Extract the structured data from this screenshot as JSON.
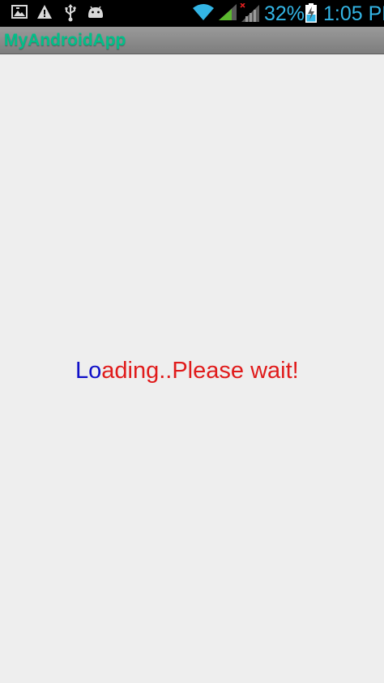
{
  "status_bar": {
    "icons_left": [
      "gallery-notification-icon",
      "warning-icon",
      "usb-icon",
      "android-debug-icon"
    ],
    "icons_right": [
      "wifi-icon",
      "signal-icon",
      "signal-no-sim-icon",
      "battery-charging-icon"
    ],
    "battery_percent": "32%",
    "time": "1:05",
    "time_suffix": "PM",
    "text_color": "#33b5e5"
  },
  "title_bar": {
    "title": "MyAndroidApp",
    "title_color": "#00c089"
  },
  "content": {
    "loading_highlight": "Lo",
    "loading_rest": "ading..Please wait!",
    "highlight_color": "#1010c8",
    "rest_color": "#e01b1b"
  }
}
